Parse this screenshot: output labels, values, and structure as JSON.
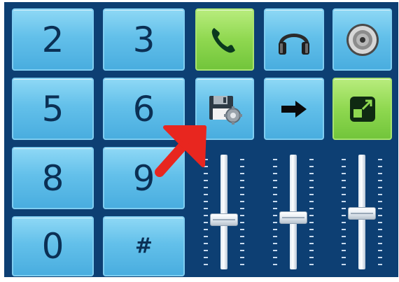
{
  "keypad": {
    "k2": "2",
    "k3": "3",
    "k5": "5",
    "k6": "6",
    "k8": "8",
    "k9": "9",
    "k0": "0",
    "khash": "#"
  },
  "icons": {
    "call": "phone-icon",
    "headset": "headphones-icon",
    "speaker": "speaker-icon",
    "save_settings": "floppy-gear-icon",
    "forward": "arrow-right-icon",
    "expand": "expand-window-icon",
    "annotation": "red-arrow-annotation"
  },
  "colors": {
    "panel": "#0d3f73",
    "key_blue": "#63c0ea",
    "key_green": "#8fd850",
    "annotation_red": "#e8261f"
  },
  "sliders": [
    {
      "name": "slider-1",
      "level": 0.44
    },
    {
      "name": "slider-2",
      "level": 0.46
    },
    {
      "name": "slider-3",
      "level": 0.5
    }
  ]
}
